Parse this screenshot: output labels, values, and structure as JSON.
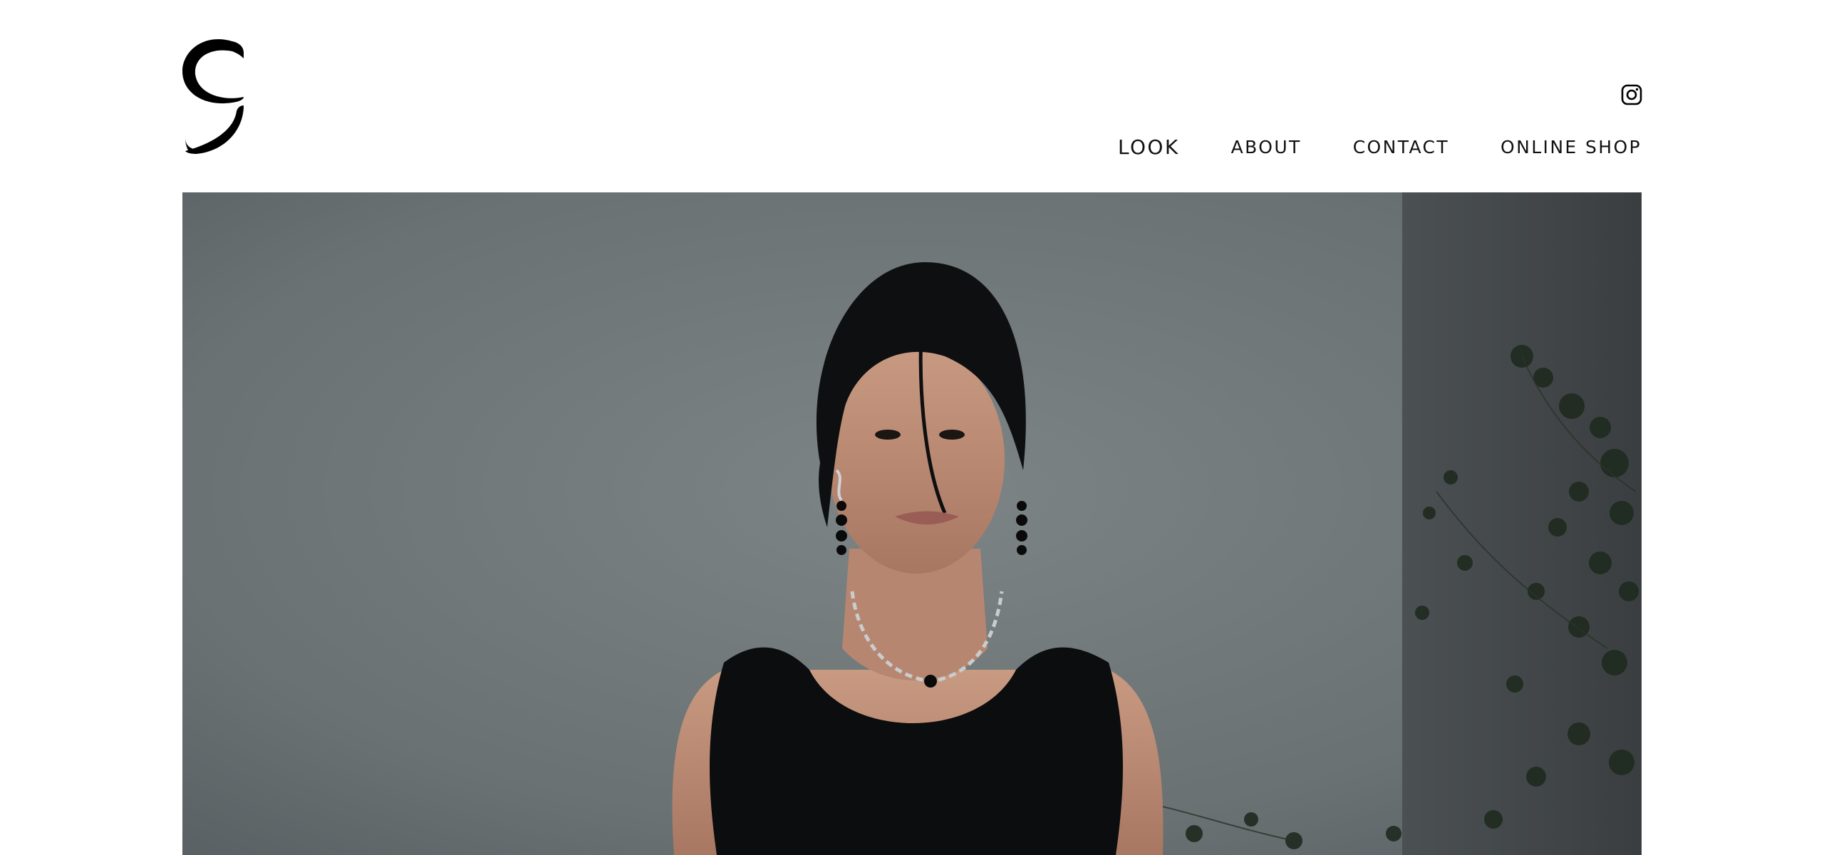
{
  "brand": {
    "logo_icon": "g-logo-icon"
  },
  "header": {
    "social": {
      "icon": "instagram-icon"
    },
    "nav": {
      "look": "LOOK",
      "about": "ABOUT",
      "contact": "CONTACT",
      "online_shop": "ONLINE SHOP"
    }
  },
  "hero": {
    "alt": "Model with short dark hair wearing a black sleeveless top, silver chain necklace with black bead and drop earrings, against a grey wall with plant leaves",
    "colors": {
      "background": "#6d7476",
      "wall_dark": "#3f4446",
      "top": "#0b0d0e",
      "skin": "#c08f78",
      "hair": "#0e0f10",
      "plant": "#1f2a20"
    }
  }
}
